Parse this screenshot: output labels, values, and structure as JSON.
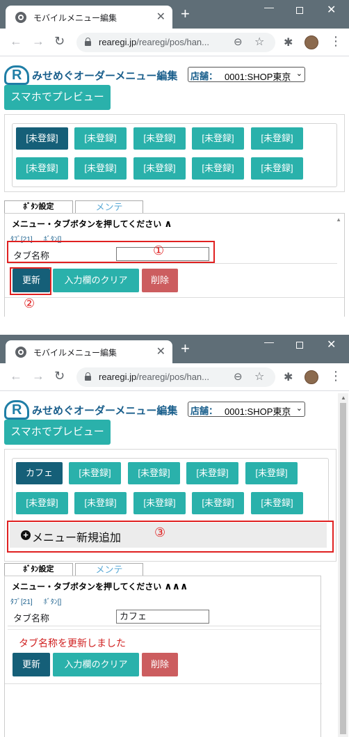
{
  "browser": {
    "tab_title": "モバイルメニュー編集",
    "tab_close": "✕",
    "new_tab": "+",
    "url_domain": "rearegi.jp",
    "url_path": "/rearegi/pos/han...",
    "back": "←",
    "forward": "→",
    "reload": "↻",
    "zoom_icon": "⊖",
    "star_icon": "☆",
    "ext_icon": "✱",
    "kebab": "⋮",
    "win_min": "—",
    "win_close": "✕"
  },
  "app": {
    "logo_letter": "R",
    "title": "みせめぐオーダーメニュー編集",
    "store_label": "店舗：",
    "store_value": "0001:SHOP東京",
    "store_caret": "⌄",
    "preview_button": "スマホでプレビュー"
  },
  "shot1": {
    "grid_buttons": [
      "[未登録]",
      "[未登録]",
      "[未登録]",
      "[未登録]",
      "[未登録]",
      "[未登録]",
      "[未登録]",
      "[未登録]",
      "[未登録]",
      "[未登録]"
    ],
    "subtab_button": "ﾎﾞﾀﾝ設定",
    "subtab_maint": "メンテ",
    "hint": "メニュー・タブボタンを押してください",
    "hint_arrows": "∧",
    "meta_tab": "ﾀﾌﾞ[21]",
    "meta_btn": "ﾎﾞﾀﾝ[]",
    "tab_name_label": "タブ名称",
    "tab_name_value": "",
    "update_button": "更新",
    "clear_button": "入力欄のクリア",
    "delete_button": "削除",
    "marker1": "①",
    "marker2": "②"
  },
  "shot2": {
    "grid_buttons": [
      "カフェ",
      "[未登録]",
      "[未登録]",
      "[未登録]",
      "[未登録]",
      "[未登録]",
      "[未登録]",
      "[未登録]",
      "[未登録]",
      "[未登録]"
    ],
    "add_menu": "メニュー新規追加",
    "add_icon": "+",
    "subtab_button": "ﾎﾞﾀﾝ設定",
    "subtab_maint": "メンテ",
    "hint": "メニュー・タブボタンを押してください",
    "hint_arrows": "∧∧∧",
    "meta_tab": "ﾀﾌﾞ[21]",
    "meta_btn": "ﾎﾞﾀﾝ[]",
    "tab_name_label": "タブ名称",
    "tab_name_value": "カフェ",
    "success_message": "タブ名称を更新しました",
    "update_button": "更新",
    "clear_button": "入力欄のクリア",
    "delete_button": "削除",
    "marker3": "③"
  }
}
